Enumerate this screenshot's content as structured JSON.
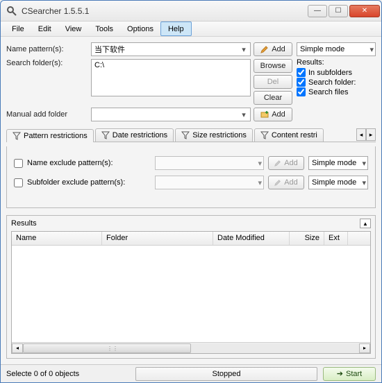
{
  "window": {
    "title": "CSearcher 1.5.5.1"
  },
  "menu": {
    "file": "File",
    "edit": "Edit",
    "view": "View",
    "tools": "Tools",
    "options": "Options",
    "help": "Help"
  },
  "form": {
    "name_pattern_label": "Name pattern(s):",
    "name_pattern_value": "当下软件",
    "search_folder_label": "Search folder(s):",
    "search_folder_value": "C:\\",
    "manual_add_label": "Manual add folder"
  },
  "buttons": {
    "add": "Add",
    "browse": "Browse",
    "del": "Del",
    "clear": "Clear"
  },
  "mode": {
    "simple": "Simple mode"
  },
  "results_opts": {
    "header": "Results:",
    "in_subfolders": "In subfolders",
    "search_folders": "Search folder:",
    "search_files": "Search files"
  },
  "tabs": {
    "pattern": "Pattern restrictions",
    "date": "Date restrictions",
    "size": "Size restrictions",
    "content": "Content restri"
  },
  "pattern_tab": {
    "name_exclude": "Name exclude pattern(s):",
    "subfolder_exclude": "Subfolder exclude pattern(s):",
    "add": "Add",
    "mode": "Simple mode"
  },
  "results": {
    "header": "Results",
    "cols": {
      "name": "Name",
      "folder": "Folder",
      "date": "Date Modified",
      "size": "Size",
      "ext": "Ext"
    }
  },
  "status": {
    "selected": "Selecte 0 of 0 objects",
    "state": "Stopped",
    "start": "Start"
  }
}
